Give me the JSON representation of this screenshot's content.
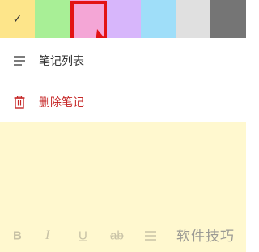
{
  "colors": {
    "swatches": [
      "#fde58a",
      "#a8ef96",
      "#f4a6d6",
      "#d7b6fb",
      "#9fdef9",
      "#e0e0e0",
      "#757575"
    ],
    "selected_index": 0,
    "highlight_index": 2,
    "highlight_color": "#e31313",
    "check_glyph": "✓"
  },
  "menu": {
    "items": [
      {
        "label": "笔记列表",
        "icon": "list-icon"
      },
      {
        "label": "删除笔记",
        "icon": "trash-icon"
      }
    ]
  },
  "format_bar": {
    "bold": "B",
    "italic": "I",
    "underline": "U",
    "strike": "ab",
    "list_icon": "list-format-icon"
  },
  "watermark": {
    "text": "软件技巧"
  }
}
